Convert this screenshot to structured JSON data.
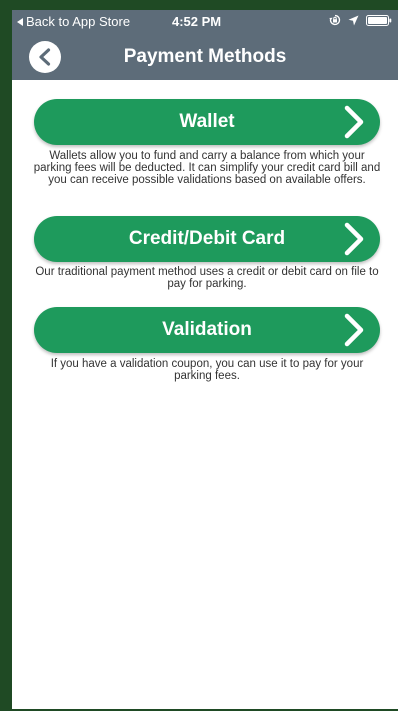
{
  "status_bar": {
    "back_label": "Back to App Store",
    "time": "4:52 PM",
    "icons": [
      "rotation-lock-icon",
      "location-icon",
      "battery-icon"
    ]
  },
  "nav": {
    "title": "Payment Methods",
    "back_icon": "chevron-left-icon"
  },
  "options": [
    {
      "label": "Wallet",
      "description": "Wallets allow you to fund and carry a balance from which your parking fees will be deducted. It can simplify your credit card bill and you can receive possible validations based on available offers."
    },
    {
      "label": "Credit/Debit Card",
      "description": "Our traditional payment method uses a credit or debit card on file to pay for parking."
    },
    {
      "label": "Validation",
      "description": "If you have a validation coupon, you can use it to pay for your parking fees."
    }
  ],
  "colors": {
    "header": "#5d6c79",
    "button": "#1e9a5c",
    "frame": "#1f4a24"
  }
}
